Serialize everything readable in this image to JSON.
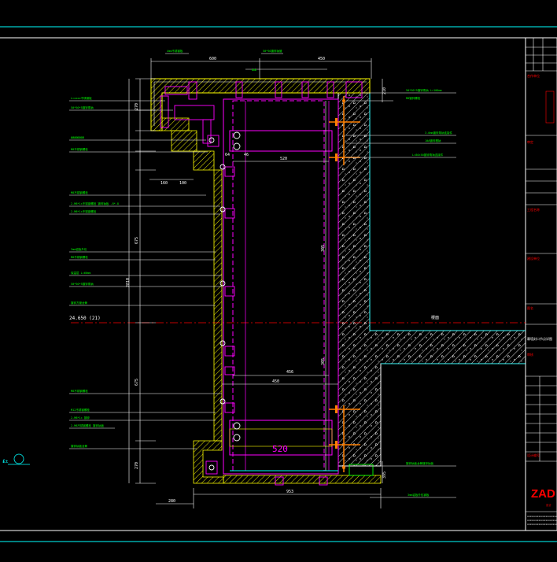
{
  "drawing": {
    "section_label_left": "24.650 (21)",
    "big_dimension": "520",
    "top_dims": [
      "600",
      "450"
    ],
    "inner_dims": [
      "520",
      "456",
      "450",
      "4010",
      "520"
    ],
    "bottom_dims": [
      "953",
      "280",
      "280"
    ],
    "vertical_dims": [
      "270",
      "590",
      "590",
      "870",
      "2810",
      "675",
      "675",
      "270",
      "210",
      "305",
      "305",
      "395"
    ],
    "small_dims": [
      "160",
      "100",
      "100",
      "64",
      "46",
      "80",
      "60",
      "60",
      "150",
      "170"
    ],
    "level_mark": "±±",
    "left_symbol": "₤±",
    "leader_labels_left": [
      "L=xxxx不锈钢板",
      "50*50*5镀锌角钠",
      "ØØØØØØØØ",
      "M8不锈钢螺栓",
      "M8不锈钢螺栓",
      "2-M8*1×不锈钢螺栓 镀锌钠板 -8*-8",
      "2-M8*1×不锈钢螺栓",
      "3mm铝板外包",
      "M8不锈钢螺栓",
      "保温层 L=60mm",
      "50*50*5镀锌角钠",
      "镀锌方管龙骨",
      "M8不锈钢螺栓",
      "M12不锈钢螺栓",
      "2-M8*1× 镀锌",
      "2-M8不锈钢螺栓 镀锌钠板",
      "镀锌钠板龙骨"
    ],
    "leader_labels_right": [
      "50*50*5镀锌角钠 L=100mm",
      "M8镀锌螺栓",
      "3.0mm镀锌角钠连接件",
      "10#镀锌槽钠",
      "L=80×50镀锌角钠连接件",
      "镀锌钠板龙骨镀锌钠板",
      "3mm铝板外包钢板"
    ],
    "note_top": [
      "4mm不锈钢板",
      "50*50镀锌钠管"
    ],
    "floor_label": "楼面"
  },
  "title_block": {
    "brand": "ZAD",
    "brand_sub": "设计",
    "rows_top": [
      "1",
      "2",
      "3",
      "4"
    ],
    "sections": [
      "合作单位",
      "审定",
      "工程名称",
      "建设单位",
      "图名",
      "审核",
      "设计编号"
    ],
    "drawing_name": "幕墙封口节点详图"
  },
  "colors": {
    "cyan": "#00ffff",
    "yellow": "#ffff00",
    "magenta": "#ff00ff",
    "green": "#00ff00",
    "white": "#ffffff",
    "orange": "#ff8000",
    "red": "#ff0000",
    "purple": "#b040ff"
  }
}
